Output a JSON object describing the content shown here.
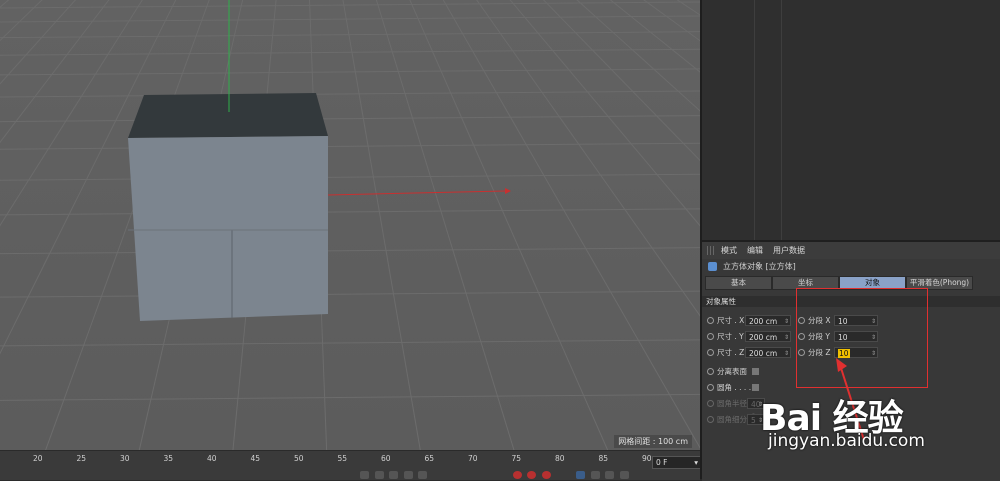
{
  "viewport": {
    "grid_spacing_label": "网格间距 : 100 cm"
  },
  "timeline": {
    "ruler_numbers": [
      "20",
      "25",
      "30",
      "35",
      "40",
      "45",
      "50",
      "55",
      "60",
      "65",
      "70",
      "75",
      "80",
      "85",
      "90"
    ],
    "current_frame": "0 F"
  },
  "attributes": {
    "menu": [
      "模式",
      "编辑",
      "用户数据"
    ],
    "object_title": "立方体对象 [立方体]",
    "tabs": [
      {
        "label": "基本",
        "active": false
      },
      {
        "label": "坐标",
        "active": false
      },
      {
        "label": "对象",
        "active": true
      },
      {
        "label": "平滑着色(Phong)",
        "active": false
      }
    ],
    "section_title": "对象属性",
    "size_x_label": "尺寸 . X",
    "size_x_value": "200 cm",
    "size_y_label": "尺寸 . Y",
    "size_y_value": "200 cm",
    "size_z_label": "尺寸 . Z",
    "size_z_value": "200 cm",
    "seg_x_label": "分段 X",
    "seg_x_value": "10",
    "seg_y_label": "分段 Y",
    "seg_y_value": "10",
    "seg_z_label": "分段 Z",
    "seg_z_value": "10",
    "separate_surfaces_label": "分离表面",
    "fillet_label": "圆角 . . . .",
    "fillet_radius_label": "圆角半径",
    "fillet_radius_value": "40 c",
    "fillet_subdiv_label": "圆角细分",
    "fillet_subdiv_value": "5"
  },
  "watermark": {
    "brand": "Bai  经验",
    "url": "jingyan.baidu.com"
  },
  "colors": {
    "active_tab": "#8aa2c8",
    "highlight_box": "#e03030",
    "axis_x": "#c83030",
    "axis_y": "#30b040"
  }
}
